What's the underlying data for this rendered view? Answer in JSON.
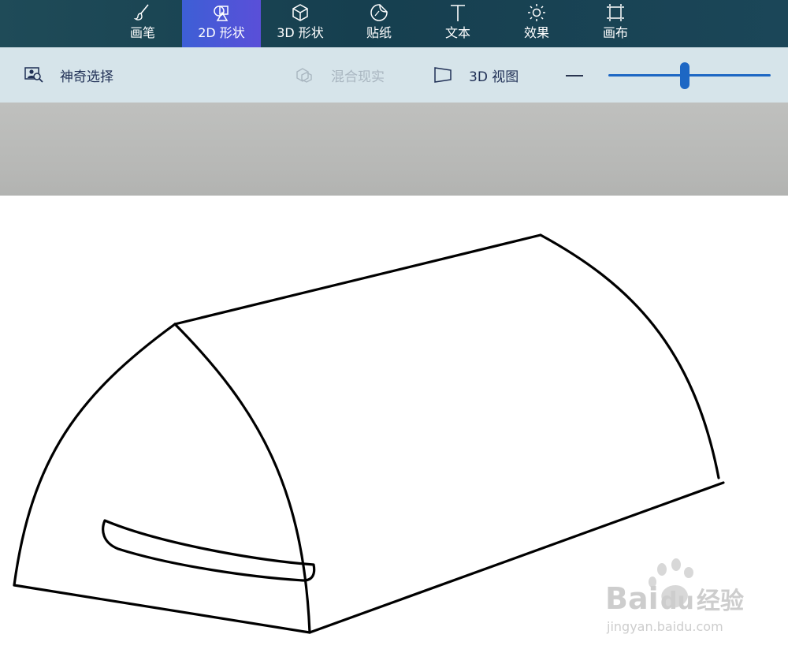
{
  "toolbar": {
    "tools": [
      {
        "label": "画笔",
        "icon": "brush-icon"
      },
      {
        "label": "2D 形状",
        "icon": "shapes-2d-icon"
      },
      {
        "label": "3D 形状",
        "icon": "cube-icon"
      },
      {
        "label": "贴纸",
        "icon": "sticker-icon"
      },
      {
        "label": "文本",
        "icon": "text-icon"
      },
      {
        "label": "效果",
        "icon": "sun-icon"
      },
      {
        "label": "画布",
        "icon": "canvas-crop-icon"
      }
    ],
    "active": "2D 形状"
  },
  "subbar": {
    "magic_select": "神奇选择",
    "mixed_reality": "混合现实",
    "view_3d": "3D 视图"
  },
  "zoom": {
    "level": 0.47
  },
  "watermark": {
    "brand": "Bai",
    "brand2": "du",
    "brand3": "经验",
    "url": "jingyan.baidu.com"
  },
  "colors": {
    "accent": "#1d67c4",
    "active_tab": "#4a57d8",
    "toolbar_bg": "#1a4352",
    "subbar_bg": "#d6e4ea"
  }
}
